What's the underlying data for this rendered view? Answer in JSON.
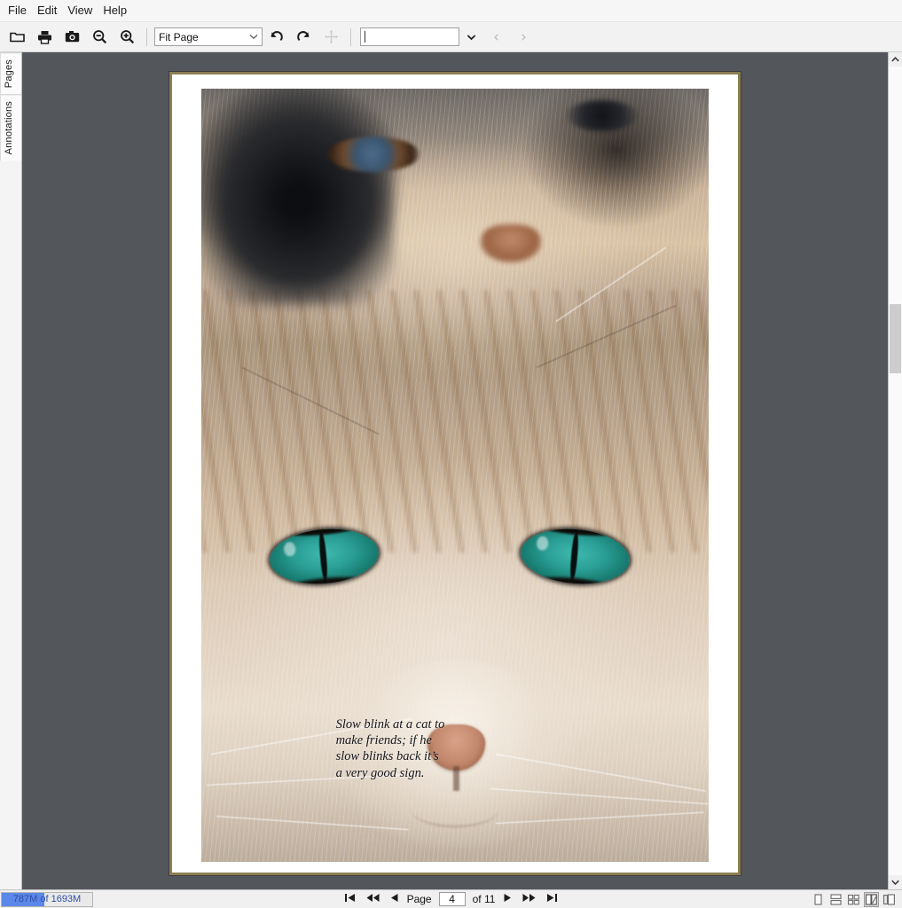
{
  "menubar": {
    "items": [
      {
        "label": "File"
      },
      {
        "label": "Edit"
      },
      {
        "label": "View"
      },
      {
        "label": "Help"
      }
    ]
  },
  "toolbar": {
    "open_tooltip": "Open",
    "print_tooltip": "Print",
    "snapshot_tooltip": "Snapshot",
    "zoom_out_tooltip": "Zoom Out",
    "zoom_in_tooltip": "Zoom In",
    "zoom_level": "Fit Page",
    "zoom_caret": "∨",
    "rotate_left_tooltip": "Rotate Left",
    "rotate_right_tooltip": "Rotate Right",
    "pan_tooltip": "Pan",
    "search_value": "",
    "search_placeholder": "",
    "search_caret": "∨",
    "find_prev": "‹",
    "find_next": "›"
  },
  "sidebar": {
    "tabs": [
      {
        "label": "Pages"
      },
      {
        "label": "Annotations"
      }
    ]
  },
  "document": {
    "caption": "Slow blink at a cat to make friends; if he slow blinks back it’s a very good sign.",
    "page_border_color": "#8a7f53",
    "viewport_background": "#53575b"
  },
  "statusbar": {
    "memory_text": "787M of 1693M",
    "memory_percent": 47,
    "memory_bar_color": "#5b87e8",
    "pager": {
      "first": "⏮",
      "fast_back": "◀◀",
      "prev": "◀",
      "page_label": "Page",
      "page_value": "4",
      "of_label": "of 11",
      "next": "▶",
      "fast_forward": "▶▶",
      "last": "⏭"
    },
    "view_modes": [
      {
        "name": "single-page",
        "active": false
      },
      {
        "name": "continuous",
        "active": false
      },
      {
        "name": "facing",
        "active": false
      },
      {
        "name": "book",
        "active": true
      },
      {
        "name": "cover",
        "active": false
      }
    ]
  },
  "scrollbar": {
    "up_arrow": "▲",
    "down_arrow": "▼"
  }
}
